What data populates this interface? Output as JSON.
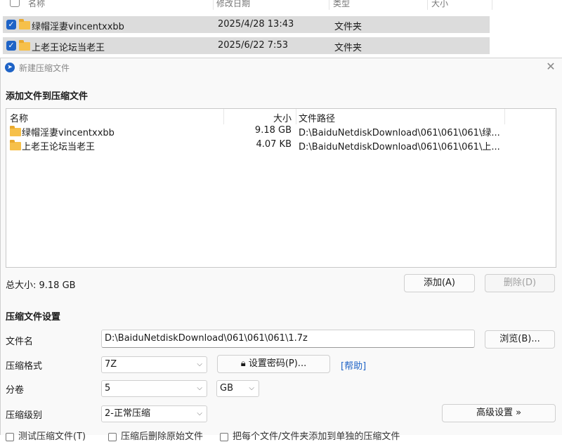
{
  "background": {
    "header": {
      "name": "名称",
      "modified": "修改日期",
      "type": "类型",
      "size": "大小"
    },
    "rows": [
      {
        "name": "绿帽淫妻vincentxxbb",
        "date": "2025/4/28 13:43",
        "type": "文件夹",
        "checked": true
      },
      {
        "name": "上老王论坛当老王",
        "date": "2025/6/22 7:53",
        "type": "文件夹",
        "checked": true
      }
    ]
  },
  "dialog": {
    "title": "新建压缩文件",
    "add_section_title": "添加文件到压缩文件",
    "columns": {
      "name": "名称",
      "size": "大小",
      "path": "文件路径"
    },
    "files": [
      {
        "name": "绿帽淫妻vincentxxbb",
        "size": "9.18 GB",
        "path": "D:\\BaiduNetdiskDownload\\061\\061\\061\\绿..."
      },
      {
        "name": "上老王论坛当老王",
        "size": "4.07 KB",
        "path": "D:\\BaiduNetdiskDownload\\061\\061\\061\\上..."
      }
    ],
    "total_size": "总大小: 9.18 GB",
    "add_button": "添加(A)",
    "delete_button": "删除(D)",
    "settings_title": "压缩文件设置",
    "filename_label": "文件名",
    "filename_value": "D:\\BaiduNetdiskDownload\\061\\061\\061\\1.7z",
    "browse_button": "浏览(B)...",
    "format_label": "压缩格式",
    "format_value": "7Z",
    "password_button": "设置密码(P)...",
    "help_link": "[帮助]",
    "split_label": "分卷",
    "split_value": "5",
    "split_unit": "GB",
    "level_label": "压缩级别",
    "level_value": "2-正常压缩",
    "advanced_button": "高级设置 »",
    "bottom_checks": [
      "测试压缩文件(T)",
      "压缩后删除原始文件",
      "把每个文件/文件夹添加到单独的压缩文件"
    ]
  },
  "colors": {
    "accent": "#1e63c6",
    "folder": "#f6c04a",
    "row_selected": "#dcdcdc"
  }
}
